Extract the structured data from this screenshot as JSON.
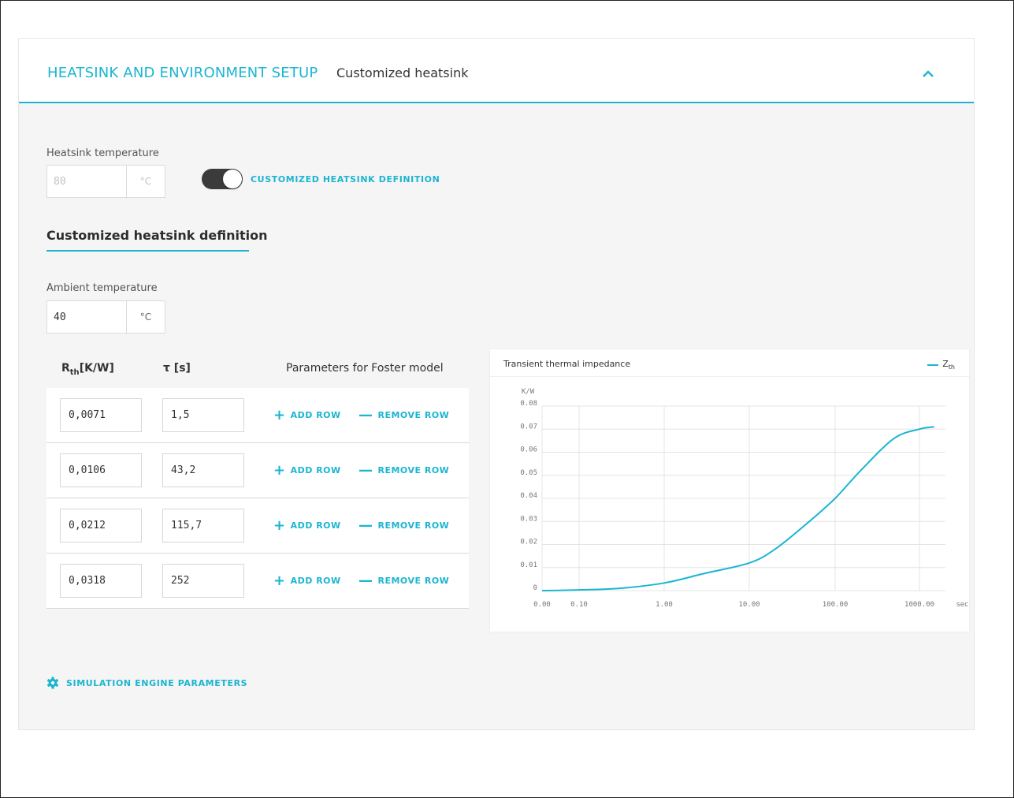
{
  "header": {
    "title": "HEATSINK AND ENVIRONMENT SETUP",
    "subtitle": "Customized heatsink"
  },
  "heatsink": {
    "label": "Heatsink temperature",
    "value": "80",
    "unit": "°C"
  },
  "toggle": {
    "label": "CUSTOMIZED HEATSINK DEFINITION",
    "on": true
  },
  "section": {
    "title": "Customized heatsink definition"
  },
  "ambient": {
    "label": "Ambient temperature",
    "value": "40",
    "unit": "°C"
  },
  "table": {
    "col1_main": "R",
    "col1_sub": "th",
    "col1_unit": "[K/W]",
    "col2": "τ [s]",
    "col3": "Parameters for Foster model",
    "add_label": "ADD ROW",
    "remove_label": "REMOVE ROW",
    "rows": [
      {
        "rth": "0,0071",
        "tau": "1,5"
      },
      {
        "rth": "0,0106",
        "tau": "43,2"
      },
      {
        "rth": "0,0212",
        "tau": "115,7"
      },
      {
        "rth": "0,0318",
        "tau": "252"
      }
    ]
  },
  "chart": {
    "title": "Transient thermal impedance",
    "legend_main": "Z",
    "legend_sub": "th"
  },
  "simulation": {
    "label": "SIMULATION ENGINE PARAMETERS"
  },
  "colors": {
    "accent": "#1bb5d1",
    "toggle_track": "#3b3b3b"
  },
  "chart_data": {
    "type": "line",
    "title": "Transient thermal impedance",
    "ylabel": "K/W",
    "xlabel": "sec",
    "y_ticks": [
      "0",
      "0.01",
      "0.02",
      "0.03",
      "0.04",
      "0.05",
      "0.06",
      "0.07",
      "0.08"
    ],
    "x_ticks": [
      "0.00",
      "0.10",
      "1.00",
      "10.00",
      "100.00",
      "1000.00"
    ],
    "ylim": [
      0,
      0.08
    ],
    "grid": true,
    "legend_position": "top-right",
    "series": [
      {
        "name": "Zth",
        "x": [
          0.0,
          0.1,
          0.3,
          1.0,
          3.0,
          10.0,
          20.0,
          50.0,
          100.0,
          200.0,
          500.0,
          1000.0,
          1500.0
        ],
        "y": [
          0.0,
          0.0003,
          0.001,
          0.0033,
          0.0075,
          0.012,
          0.018,
          0.03,
          0.04,
          0.052,
          0.066,
          0.07,
          0.071
        ]
      }
    ]
  }
}
